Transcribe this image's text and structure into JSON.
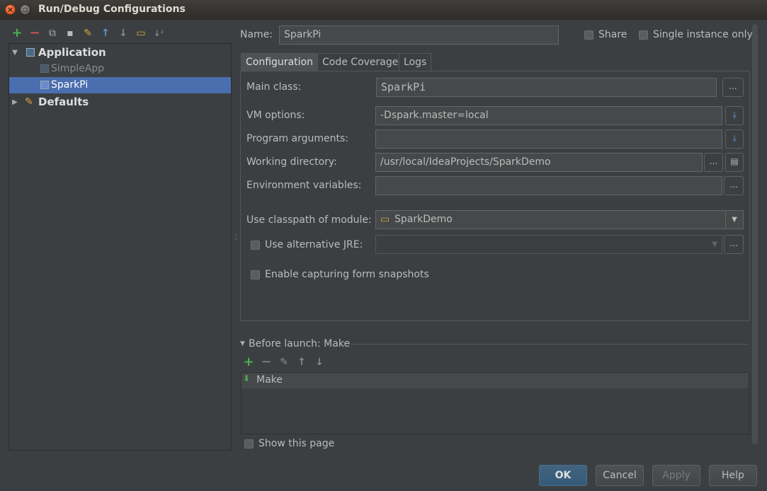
{
  "window": {
    "title": "Run/Debug Configurations"
  },
  "toolbar": {
    "add": "+",
    "remove": "−",
    "copy": "⧉",
    "save": "▪",
    "edit_defaults": "✎",
    "move_up": "↑",
    "move_down": "↓",
    "folder": "▭",
    "sort": "↓ᶻ"
  },
  "tree": {
    "application": "Application",
    "simpleapp": "SimpleApp",
    "sparkpi": "SparkPi",
    "defaults": "Defaults"
  },
  "header": {
    "name_label": "Name:",
    "name_value": "SparkPi",
    "share_label": "Share",
    "single_instance_label": "Single instance only"
  },
  "tabs": [
    "Configuration",
    "Code Coverage",
    "Logs"
  ],
  "form": {
    "main_class_label": "Main class:",
    "main_class_value": "SparkPi",
    "vm_options_label": "VM options:",
    "vm_options_value": "-Dspark.master=local",
    "program_args_label": "Program arguments:",
    "program_args_value": "",
    "working_dir_label": "Working directory:",
    "working_dir_value": "/usr/local/IdeaProjects/SparkDemo",
    "env_vars_label": "Environment variables:",
    "env_vars_value": "",
    "classpath_label": "Use classpath of module:",
    "classpath_value": "SparkDemo",
    "alt_jre_label": "Use alternative JRE:",
    "snapshots_label": "Enable capturing form snapshots",
    "ellipsis": "...",
    "dropdown_arrow": "▼"
  },
  "before_launch": {
    "label": "Before launch: Make",
    "items": [
      "Make"
    ]
  },
  "footer": {
    "show_page_label": "Show this page",
    "ok": "OK",
    "cancel": "Cancel",
    "apply": "Apply",
    "help": "Help"
  },
  "colors": {
    "selection": "#4b6eaf",
    "add_green": "#4caf50",
    "remove_red": "#c75450"
  }
}
